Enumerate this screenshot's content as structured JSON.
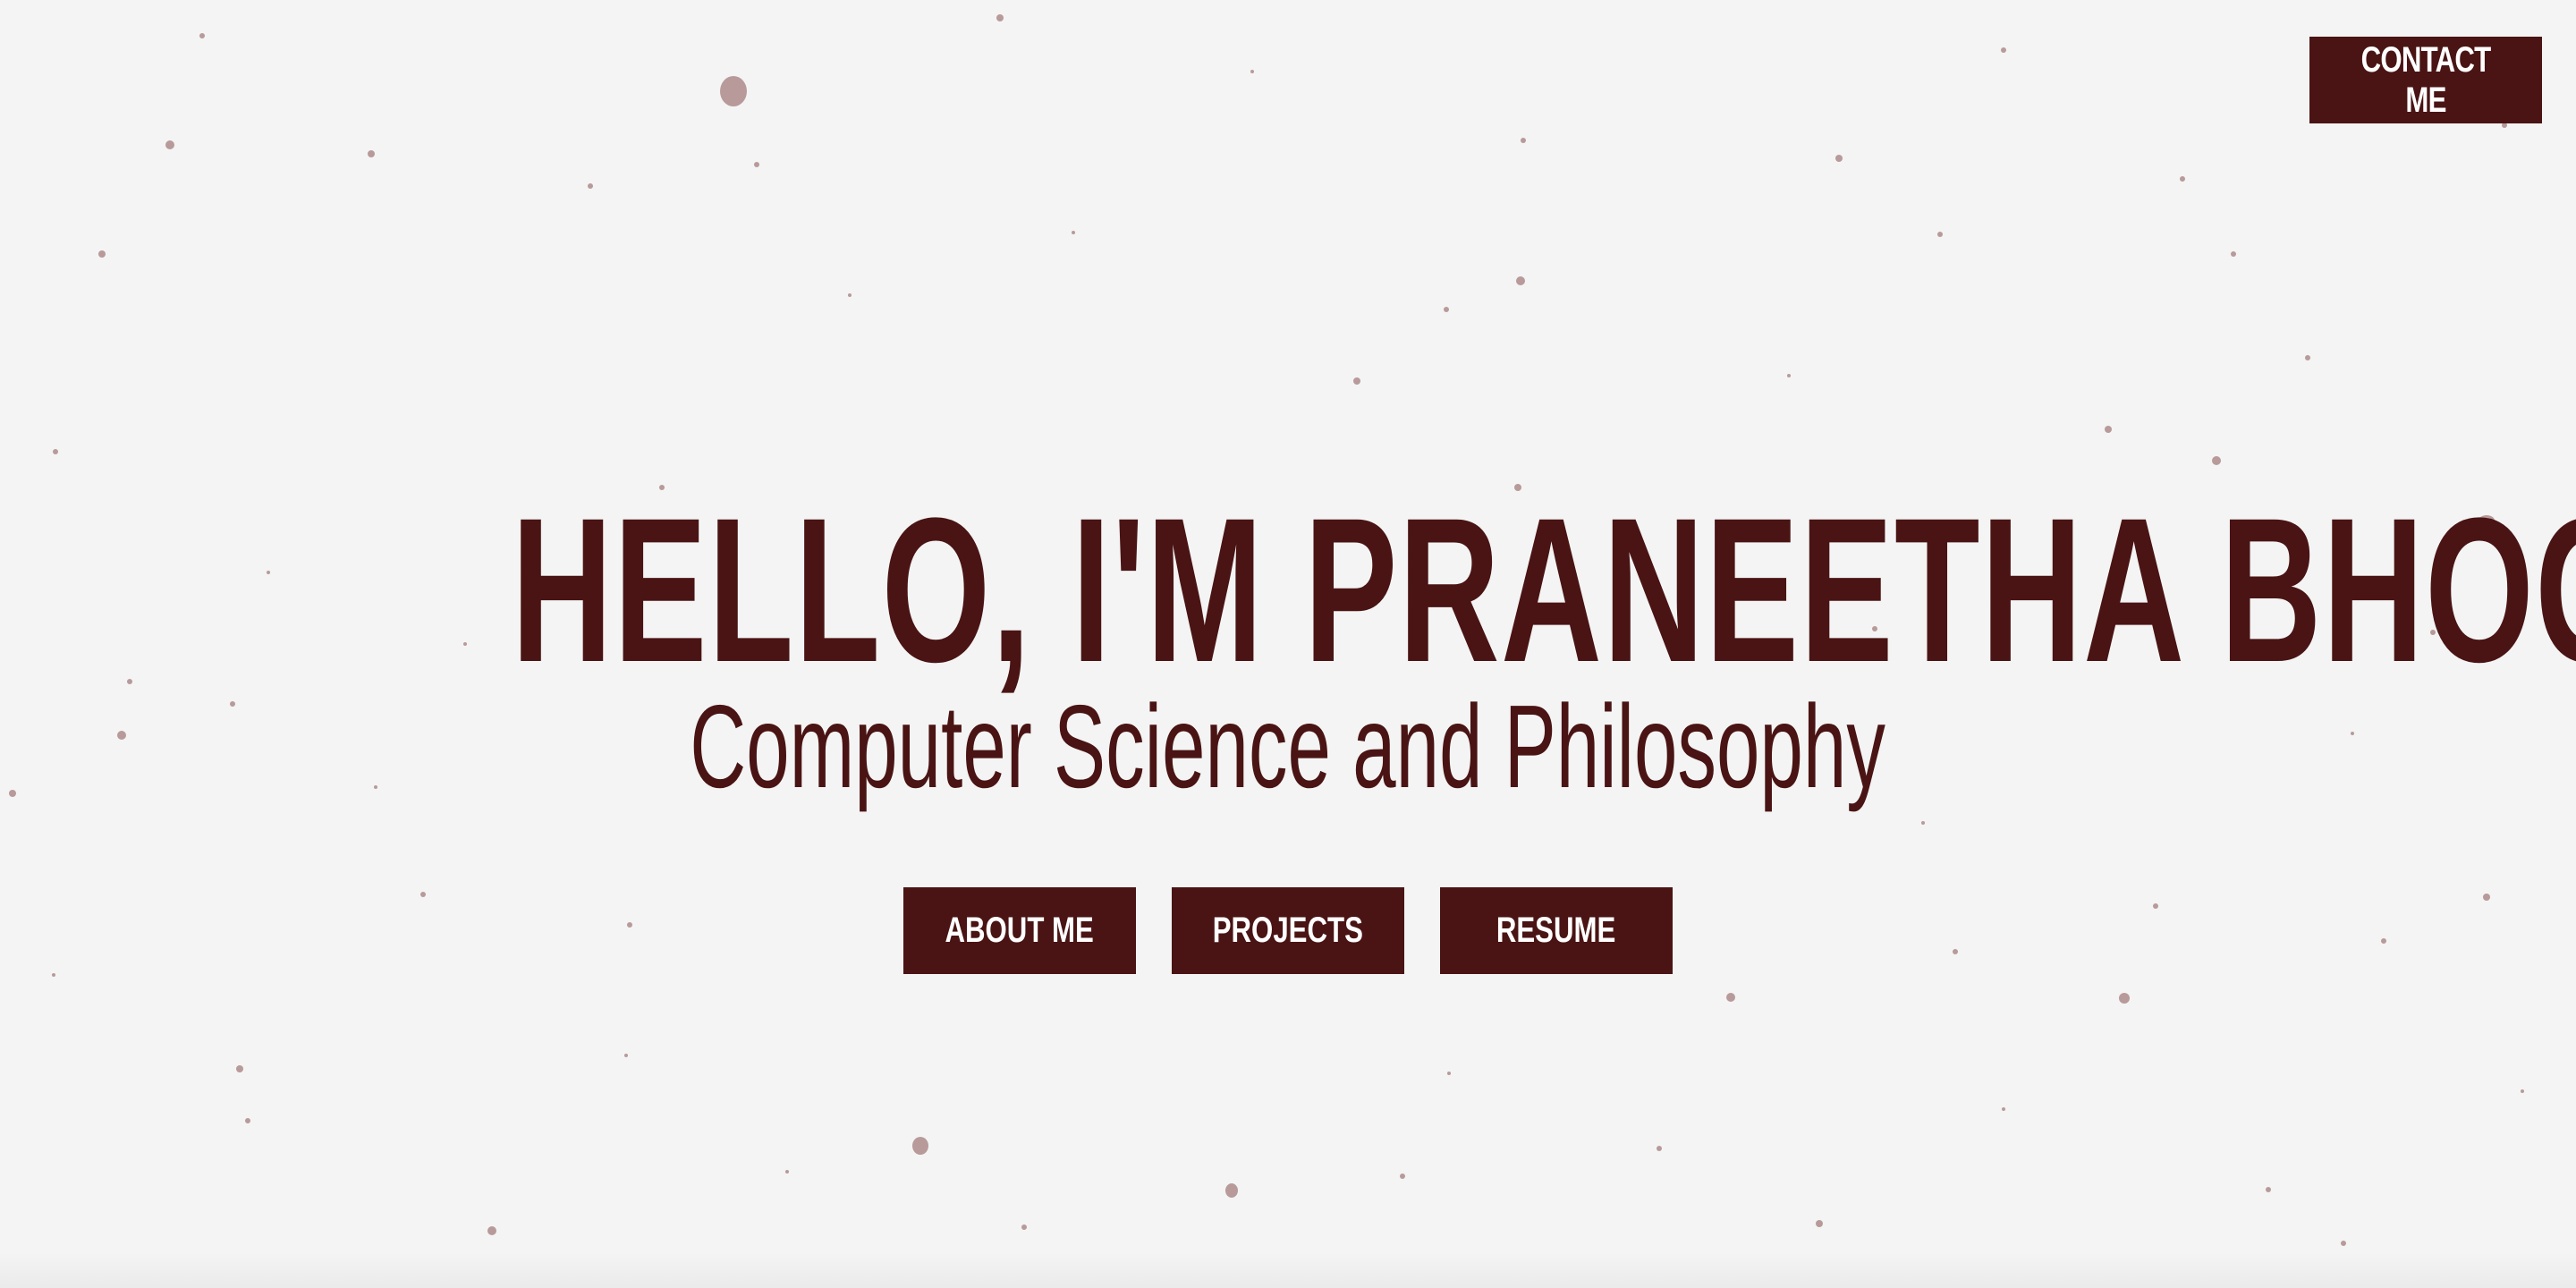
{
  "header": {
    "contact_label": "CONTACT ME"
  },
  "hero": {
    "title": "HELLO, I'M PRANEETHA BHOGI",
    "subtitle": "Computer Science and Philosophy"
  },
  "nav": {
    "items": [
      {
        "label": "ABOUT ME"
      },
      {
        "label": "PROJECTS"
      },
      {
        "label": "RESUME"
      }
    ]
  },
  "colors": {
    "accent": "#4a1414",
    "background": "#f4f4f4",
    "speckle": "#b89a9a"
  }
}
